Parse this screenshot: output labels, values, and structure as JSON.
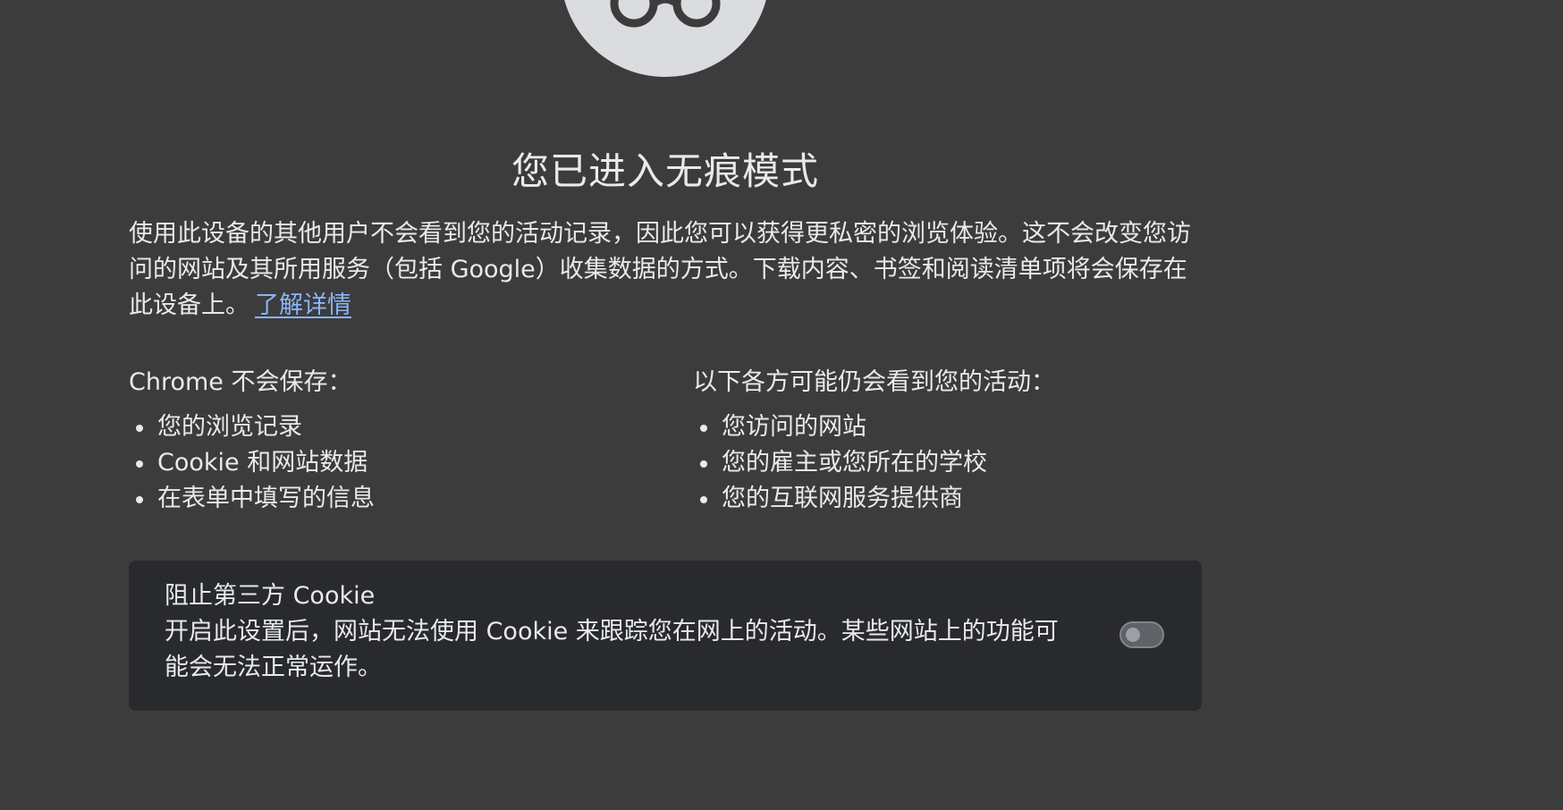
{
  "header": {
    "title": "您已进入无痕模式",
    "icon": "incognito-icon"
  },
  "intro": {
    "text": "使用此设备的其他用户不会看到您的活动记录，因此您可以获得更私密的浏览体验。这不会改变您访问的网站及其所用服务（包括 Google）收集数据的方式。下载内容、书签和阅读清单项将会保存在此设备上。",
    "learn_more": "了解详情"
  },
  "not_saved": {
    "title": "Chrome 不会保存：",
    "items": [
      "您的浏览记录",
      "Cookie 和网站数据",
      "在表单中填写的信息"
    ]
  },
  "may_see": {
    "title": "以下各方可能仍会看到您的活动：",
    "items": [
      "您访问的网站",
      "您的雇主或您所在的学校",
      "您的互联网服务提供商"
    ]
  },
  "cookie_control": {
    "title": "阻止第三方 Cookie",
    "description": "开启此设置后，网站无法使用 Cookie 来跟踪您在网上的活动。某些网站上的功能可能会无法正常运作。",
    "toggle_on": false
  },
  "colors": {
    "background": "#3c3c3c",
    "card": "#292a2d",
    "link": "#8ab4f8",
    "text": "#e8eaed"
  }
}
